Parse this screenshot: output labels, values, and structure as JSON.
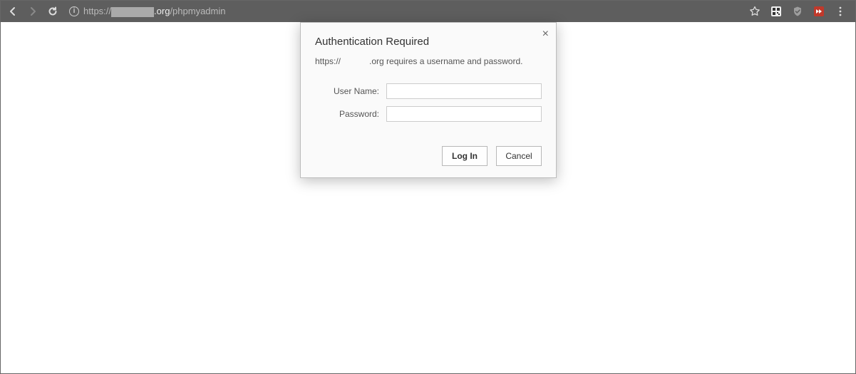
{
  "toolbar": {
    "url_prefix": "https://",
    "url_domain_suffix": ".org",
    "url_path": "/phpmyadmin"
  },
  "dialog": {
    "title": "Authentication Required",
    "message_prefix": "https://",
    "message_suffix": ".org requires a username and password.",
    "username_label": "User Name:",
    "password_label": "Password:",
    "username_value": "",
    "password_value": "",
    "login_label": "Log In",
    "cancel_label": "Cancel"
  }
}
